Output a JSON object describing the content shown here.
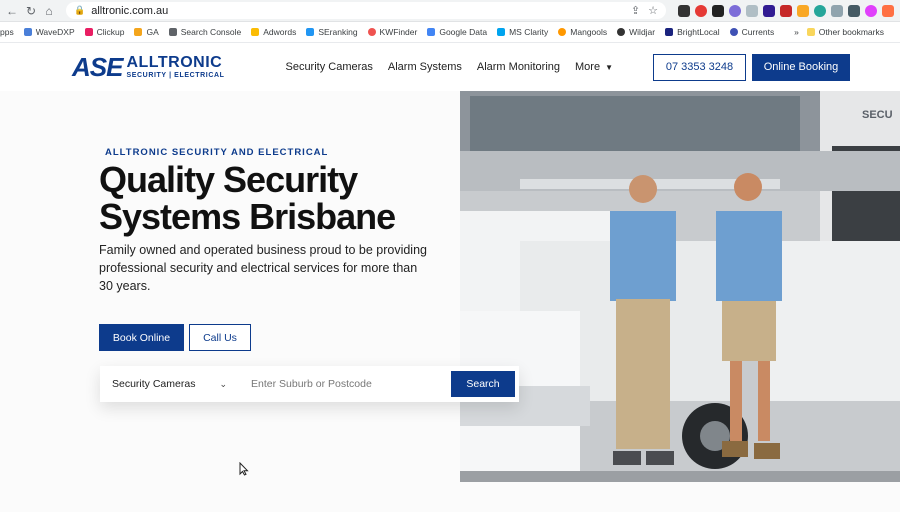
{
  "browser": {
    "url": "alltronic.com.au"
  },
  "bookmarks": [
    "pps",
    "WaveDXP",
    "Clickup",
    "GA",
    "Search Console",
    "Adwords",
    "SEranking",
    "KWFinder",
    "Google Data",
    "MS Clarity",
    "Mangools",
    "Wildjar",
    "BrightLocal",
    "Currents"
  ],
  "bookmarks_more": "»",
  "other_bookmarks": "Other bookmarks",
  "logo": {
    "mark": "ASE",
    "name": "ALLTRONIC",
    "sub": "SECURITY | ELECTRICAL"
  },
  "nav": {
    "items": [
      "Security Cameras",
      "Alarm Systems",
      "Alarm Monitoring",
      "More"
    ],
    "phone": "07 3353 3248",
    "booking": "Online Booking"
  },
  "hero": {
    "tagline": "ALLTRONIC SECURITY AND ELECTRICAL",
    "title": "Quality Security Systems Brisbane",
    "lead": "Family owned and operated business proud to be providing professional security and electrical services for more than 30 years.",
    "book_btn": "Book Online",
    "call_btn": "Call Us"
  },
  "search": {
    "service": "Security Cameras",
    "placeholder": "Enter Suburb or Postcode",
    "button": "Search"
  },
  "photo_signage": "SECU"
}
